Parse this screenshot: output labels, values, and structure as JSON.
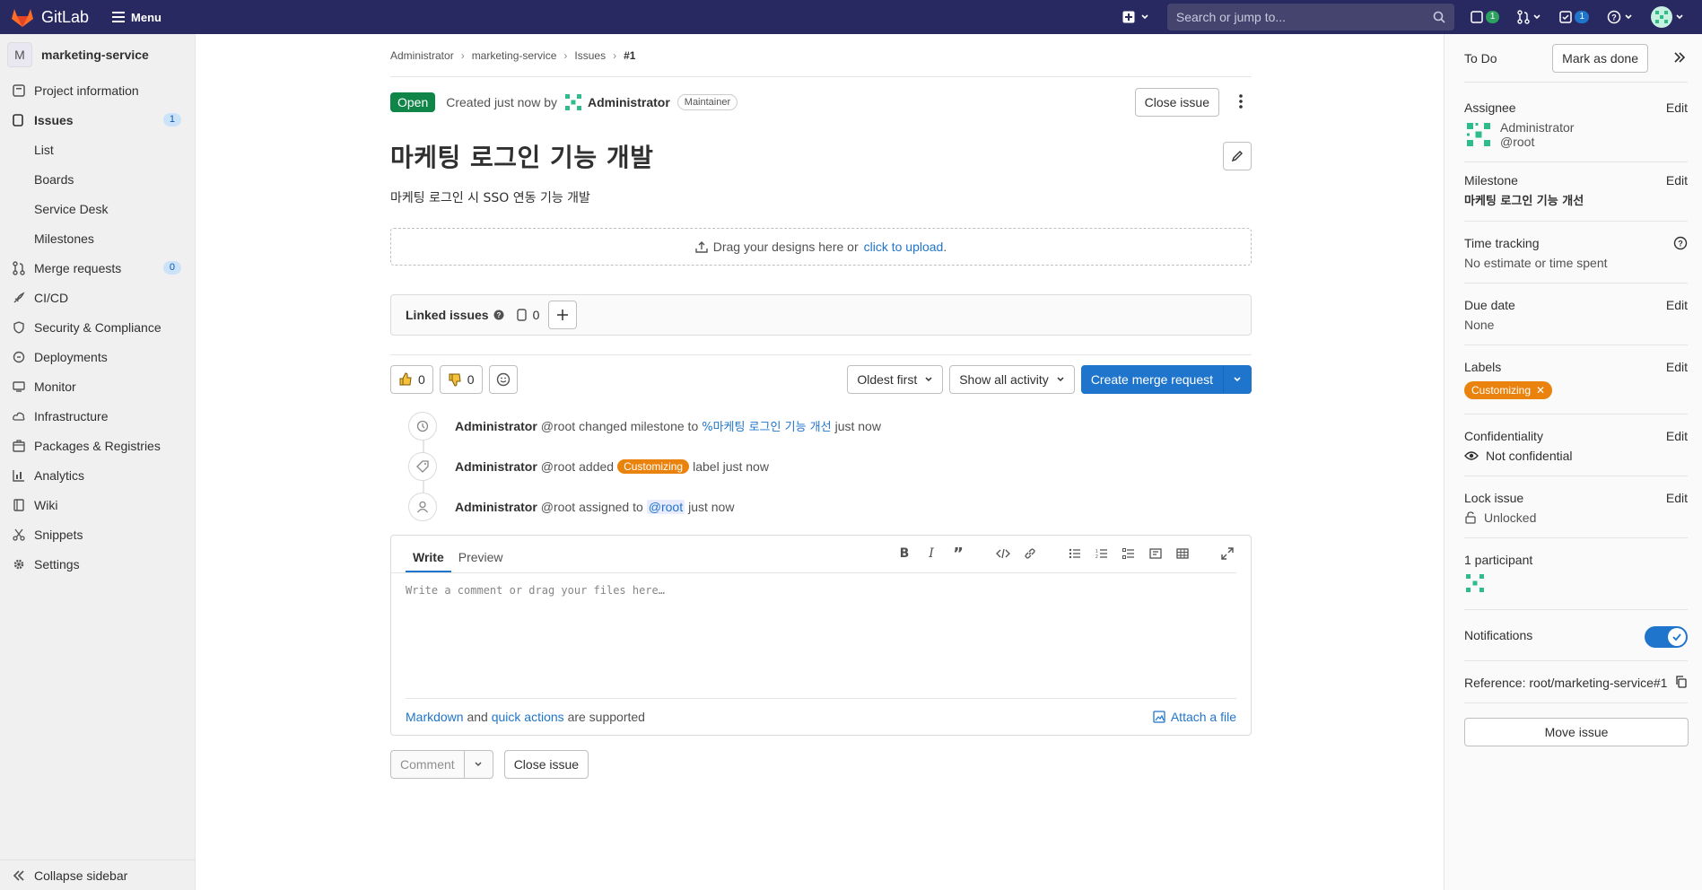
{
  "topbar": {
    "brand": "GitLab",
    "menu_label": "Menu",
    "search_placeholder": "Search or jump to...",
    "issues_count": "1",
    "todos_count": "1"
  },
  "sidebar": {
    "project_initial": "M",
    "project_name": "marketing-service",
    "items": [
      {
        "label": "Project information"
      },
      {
        "label": "Issues",
        "count": "1"
      },
      {
        "label": "Merge requests",
        "count": "0"
      },
      {
        "label": "CI/CD"
      },
      {
        "label": "Security & Compliance"
      },
      {
        "label": "Deployments"
      },
      {
        "label": "Monitor"
      },
      {
        "label": "Infrastructure"
      },
      {
        "label": "Packages & Registries"
      },
      {
        "label": "Analytics"
      },
      {
        "label": "Wiki"
      },
      {
        "label": "Snippets"
      },
      {
        "label": "Settings"
      }
    ],
    "issue_subitems": [
      "List",
      "Boards",
      "Service Desk",
      "Milestones"
    ],
    "collapse_label": "Collapse sidebar"
  },
  "breadcrumb": [
    "Administrator",
    "marketing-service",
    "Issues",
    "#1"
  ],
  "issue": {
    "status": "Open",
    "created_text": "Created just now by",
    "author": "Administrator",
    "author_role": "Maintainer",
    "close_label": "Close issue",
    "title": "마케팅 로그인 기능 개발",
    "description": "마케팅 로그인 시 SSO 연동 기능 개발"
  },
  "dropzone": {
    "text": "Drag your designs here or",
    "link": "click to upload",
    "suffix": "."
  },
  "linked_issues": {
    "label": "Linked issues",
    "count": "0"
  },
  "actions": {
    "thumbs_up": "0",
    "thumbs_down": "0",
    "sort_label": "Oldest first",
    "filter_label": "Show all activity",
    "create_mr_label": "Create merge request"
  },
  "timeline": [
    {
      "user": "Administrator",
      "handle": "@root",
      "action": "changed milestone to",
      "target": "%마케팅 로그인 기능 개선",
      "time": "just now"
    },
    {
      "user": "Administrator",
      "handle": "@root",
      "action": "added",
      "label": "Customizing",
      "after": "label just now"
    },
    {
      "user": "Administrator",
      "handle": "@root",
      "action": "assigned to",
      "mention": "@root",
      "time": "just now"
    }
  ],
  "comment": {
    "tab_write": "Write",
    "tab_preview": "Preview",
    "placeholder": "Write a comment or drag your files here…",
    "markdown_link": "Markdown",
    "and": "and",
    "quick_actions_link": "quick actions",
    "supported": "are supported",
    "attach_label": "Attach a file",
    "comment_btn": "Comment",
    "close_btn": "Close issue"
  },
  "right_sidebar": {
    "todo_label": "To Do",
    "mark_done": "Mark as done",
    "edit_label": "Edit",
    "assignee_title": "Assignee",
    "assignee_name": "Administrator",
    "assignee_handle": "@root",
    "milestone_title": "Milestone",
    "milestone_value": "마케팅 로그인 기능 개선",
    "time_title": "Time tracking",
    "time_value": "No estimate or time spent",
    "due_title": "Due date",
    "due_value": "None",
    "labels_title": "Labels",
    "label_value": "Customizing",
    "conf_title": "Confidentiality",
    "conf_value": "Not confidential",
    "lock_title": "Lock issue",
    "lock_value": "Unlocked",
    "participants": "1 participant",
    "notifications": "Notifications",
    "reference": "Reference: root/marketing-service#1",
    "move_issue": "Move issue"
  },
  "colors": {
    "topbar": "#292961",
    "primary": "#1f75cb",
    "open_badge": "#108548",
    "label_orange": "#e9830d"
  }
}
